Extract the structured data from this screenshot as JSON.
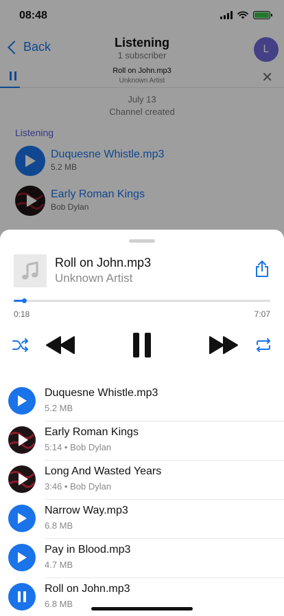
{
  "status_bar": {
    "time": "08:48"
  },
  "nav": {
    "back_label": "Back",
    "title": "Listening",
    "subtitle": "1 subscriber",
    "avatar_initial": "L"
  },
  "mini_player": {
    "title": "Roll on John.mp3",
    "artist": "Unknown Artist",
    "progress": 0.07
  },
  "chat": {
    "date": "July 13",
    "event": "Channel created",
    "bubble_label": "Listening",
    "items": [
      {
        "title": "Duquesne Whistle.mp3",
        "subtitle": "5.2 MB",
        "icon": "play-icon"
      },
      {
        "title": "Early Roman Kings",
        "subtitle": "Bob Dylan",
        "icon": "album-art-icon"
      }
    ]
  },
  "now_playing": {
    "title": "Roll on John.mp3",
    "artist": "Unknown Artist",
    "elapsed": "0:18",
    "duration": "7:07",
    "progress": 0.04
  },
  "playlist": [
    {
      "title": "Duquesne Whistle.mp3",
      "subtitle": "5.2 MB",
      "icon": "play",
      "state": "idle"
    },
    {
      "title": "Early Roman Kings",
      "subtitle": "5:14 • Bob Dylan",
      "icon": "album",
      "state": "idle"
    },
    {
      "title": "Long And Wasted Years",
      "subtitle": "3:46 • Bob Dylan",
      "icon": "album",
      "state": "idle"
    },
    {
      "title": "Narrow Way.mp3",
      "subtitle": "6.8 MB",
      "icon": "play",
      "state": "idle"
    },
    {
      "title": "Pay in Blood.mp3",
      "subtitle": "4.7 MB",
      "icon": "play",
      "state": "idle"
    },
    {
      "title": "Roll on John.mp3",
      "subtitle": "6.8 MB",
      "icon": "pause",
      "state": "playing"
    }
  ],
  "colors": {
    "accent": "#1a73e8",
    "avatar": "#6f68d8",
    "battery": "#39c24a",
    "bubble_label": "#5b5bd6"
  }
}
